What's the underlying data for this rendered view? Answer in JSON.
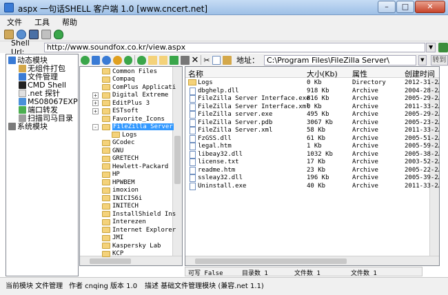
{
  "window": {
    "title": "aspx 一句话SHELL 客户端 1.0 [www.cncert.net]",
    "buttons": [
      "–",
      "□",
      "✕"
    ]
  },
  "menu": [
    "文件",
    "工具",
    "帮助"
  ],
  "shell_url": {
    "label": "Shell Url:",
    "value": "http://www.soundfox.co.kr/view.aspx"
  },
  "modules": [
    {
      "label": "动态模块",
      "icon": "module-icon",
      "color": "#3a7bd5"
    },
    {
      "label": "无组件打包",
      "icon": "package-icon",
      "color": "#d4a84a"
    },
    {
      "label": "文件管理",
      "icon": "file-manager-icon",
      "color": "#3a7bd5"
    },
    {
      "label": "CMD Shell",
      "icon": "cmd-icon",
      "color": "#222222"
    },
    {
      "label": ".net 探针",
      "icon": "probe-icon",
      "color": "#e0e0e0"
    },
    {
      "label": "MS08067EXP",
      "icon": "exploit-icon",
      "color": "#4a90d9"
    },
    {
      "label": "端口转发",
      "icon": "port-icon",
      "color": "#4caf50"
    },
    {
      "label": "扫描司马目录",
      "icon": "scan-icon",
      "color": "#9e9e9e"
    },
    {
      "label": "系统模块",
      "icon": "system-module-icon",
      "color": "#7b7b7b"
    }
  ],
  "address": {
    "label": "地址：",
    "value": "C:\\Program Files\\FileZilla Server\\",
    "goto": "转到"
  },
  "folders": [
    {
      "name": "Common Files",
      "expand": ""
    },
    {
      "name": "Compaq",
      "expand": ""
    },
    {
      "name": "ComPlus Applicati",
      "expand": ""
    },
    {
      "name": "Digital Extreme",
      "expand": "+"
    },
    {
      "name": "EditPlus 3",
      "expand": "+"
    },
    {
      "name": "ESTsoft",
      "expand": "+"
    },
    {
      "name": "Favorite_Icons",
      "expand": ""
    },
    {
      "name": "FileZilla Server",
      "expand": "-",
      "selected": true
    },
    {
      "name": "Logs",
      "expand": "",
      "child": true
    },
    {
      "name": "GCodec",
      "expand": ""
    },
    {
      "name": "GNU",
      "expand": ""
    },
    {
      "name": "GRETECH",
      "expand": ""
    },
    {
      "name": "Hewlett-Packard",
      "expand": ""
    },
    {
      "name": "HP",
      "expand": ""
    },
    {
      "name": "HPWBEM",
      "expand": ""
    },
    {
      "name": "imoxion",
      "expand": ""
    },
    {
      "name": "INICIS6i",
      "expand": ""
    },
    {
      "name": "INITECH",
      "expand": ""
    },
    {
      "name": "InstallShield Ins",
      "expand": ""
    },
    {
      "name": "Interezen",
      "expand": ""
    },
    {
      "name": "Internet Explorer",
      "expand": ""
    },
    {
      "name": "JMI",
      "expand": ""
    },
    {
      "name": "Kaspersky Lab",
      "expand": ""
    },
    {
      "name": "KCP",
      "expand": ""
    }
  ],
  "file_columns": [
    "名称",
    "大小(Kb)",
    "属性",
    "创建时间"
  ],
  "files": [
    {
      "name": "Logs",
      "size": "0 Kb",
      "attr": "Directory",
      "time": "2012-31-2…",
      "type": "folder"
    },
    {
      "name": "dbghelp.dll",
      "size": "918 Kb",
      "attr": "Archive",
      "time": "2004-28-2…",
      "type": "file"
    },
    {
      "name": "FileZilla Server Interface.exe",
      "size": "816 Kb",
      "attr": "Archive",
      "time": "2005-29-2…",
      "type": "file"
    },
    {
      "name": "FileZilla Server Interface.xml",
      "size": "0 Kb",
      "attr": "Archive",
      "time": "2011-33-2…",
      "type": "file"
    },
    {
      "name": "FileZilla server.exe",
      "size": "495 Kb",
      "attr": "Archive",
      "time": "2005-29-2…",
      "type": "file"
    },
    {
      "name": "FileZilla Server.pdb",
      "size": "3067 Kb",
      "attr": "Archive",
      "time": "2005-23-2…",
      "type": "file"
    },
    {
      "name": "FileZilla Server.xml",
      "size": "58 Kb",
      "attr": "Archive",
      "time": "2011-33-2…",
      "type": "file"
    },
    {
      "name": "FzGSS.dll",
      "size": "61 Kb",
      "attr": "Archive",
      "time": "2005-51-2…",
      "type": "file"
    },
    {
      "name": "legal.htm",
      "size": "1 Kb",
      "attr": "Archive",
      "time": "2005-59-2…",
      "type": "file"
    },
    {
      "name": "libeay32.dll",
      "size": "1032 Kb",
      "attr": "Archive",
      "time": "2005-38-2…",
      "type": "file"
    },
    {
      "name": "license.txt",
      "size": "17 Kb",
      "attr": "Archive",
      "time": "2003-52-2…",
      "type": "file"
    },
    {
      "name": "readme.htm",
      "size": "23 Kb",
      "attr": "Archive",
      "time": "2005-22-2…",
      "type": "file"
    },
    {
      "name": "ssleay32.dll",
      "size": "196 Kb",
      "attr": "Archive",
      "time": "2005-39-2…",
      "type": "file"
    },
    {
      "name": "Uninstall.exe",
      "size": "40 Kb",
      "attr": "Archive",
      "time": "2011-33-2…",
      "type": "file"
    }
  ],
  "info": {
    "writable": "可写 False",
    "dir_count": "目录数 1",
    "file_count": "文件数 1",
    "file_count2": "文件数 1"
  },
  "status": {
    "current_module": "当前模块  文件管理",
    "author": "作者  cnqing",
    "version": "版本 1.0",
    "description": "描述  基础文件管理模块  (兼容.net 1.1)"
  }
}
